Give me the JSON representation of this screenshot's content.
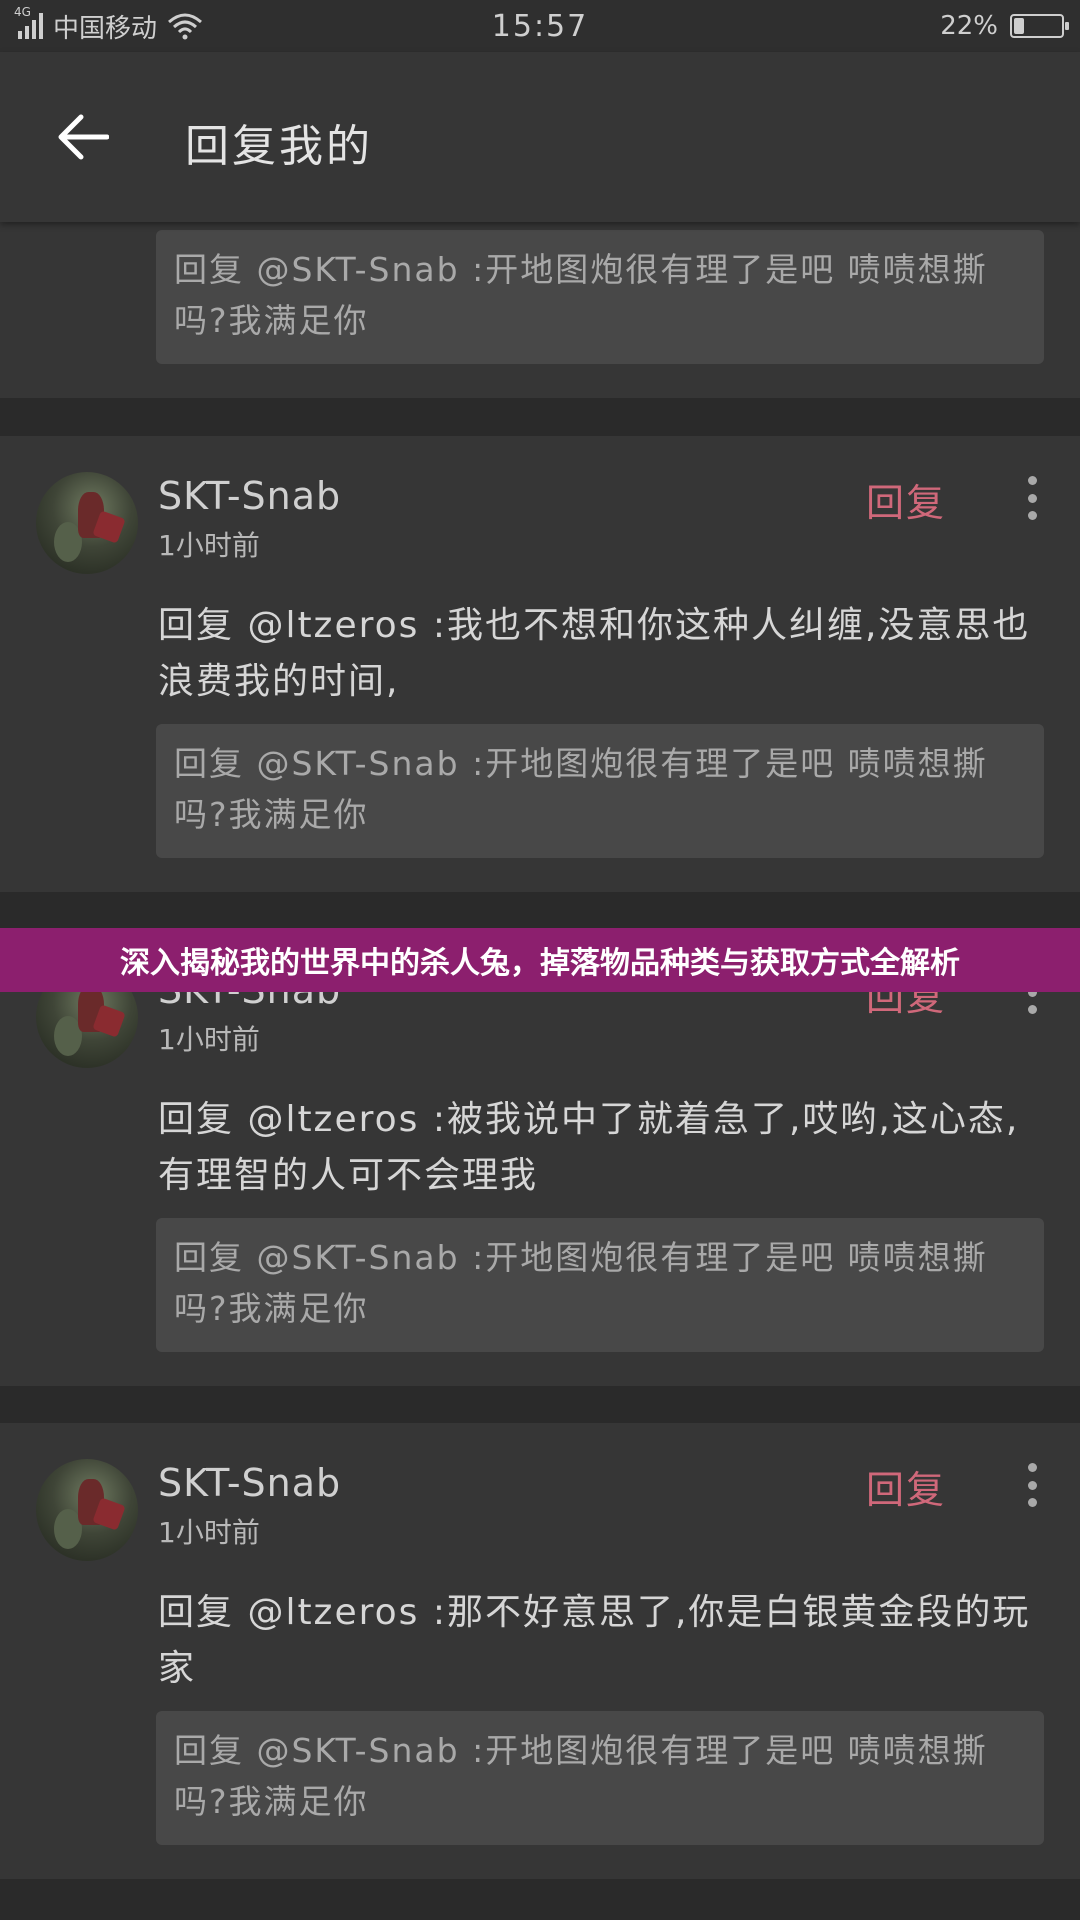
{
  "status_bar": {
    "network_type": "4G",
    "carrier": "中国移动",
    "time": "15:57",
    "battery_percent": "22%",
    "battery_level": 0.22
  },
  "app_bar": {
    "back_icon": "arrow-left-icon",
    "title": "回复我的"
  },
  "top_partial_quote": "回复 @SKT-Snab :开地图炮很有理了是吧 啧啧想撕吗?我满足你",
  "comments": [
    {
      "username": "SKT-Snab",
      "time": "1小时前",
      "reply_label": "回复",
      "more_icon": "more-vert-icon",
      "content": "回复 @ltzeros :我也不想和你这种人纠缠,没意思也浪费我的时间,",
      "quote": "回复 @SKT-Snab :开地图炮很有理了是吧 啧啧想撕吗?我满足你"
    },
    {
      "username": "SKT-Snab",
      "time": "1小时前",
      "reply_label": "回复",
      "more_icon": "more-vert-icon",
      "content": "回复 @ltzeros :被我说中了就着急了,哎哟,这心态,有理智的人可不会理我",
      "quote": "回复 @SKT-Snab :开地图炮很有理了是吧 啧啧想撕吗?我满足你"
    },
    {
      "username": "SKT-Snab",
      "time": "1小时前",
      "reply_label": "回复",
      "more_icon": "more-vert-icon",
      "content": "回复 @ltzeros :那不好意思了,你是白银黄金段的玩家",
      "quote": "回复 @SKT-Snab :开地图炮很有理了是吧 啧啧想撕吗?我满足你"
    }
  ],
  "banner": {
    "text": "深入揭秘我的世界中的杀人兔，掉落物品种类与获取方式全解析"
  },
  "colors": {
    "background": "#2a2a2a",
    "card": "#363636",
    "quote_box": "#484848",
    "reply_accent": "#d0687a",
    "banner": "#8c1f6e"
  }
}
